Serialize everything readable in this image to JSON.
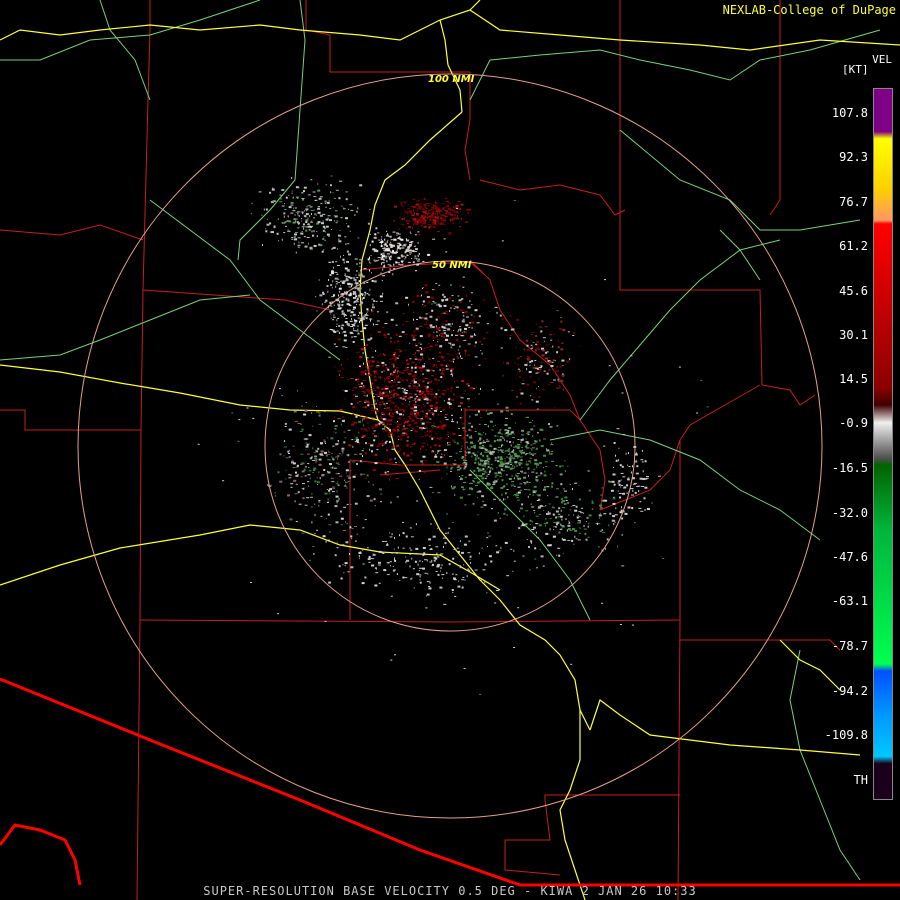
{
  "credit": "NEXLAB-College of DuPage",
  "footer": "SUPER-RESOLUTION BASE VELOCITY 0.5 DEG - KIWA 2 JAN 26 10:33",
  "legend": {
    "product": "VEL",
    "unit": "[KT]",
    "labels": [
      "107.8",
      "92.3",
      "76.7",
      "61.2",
      "45.6",
      "30.1",
      "14.5",
      "-0.9",
      "-16.5",
      "-32.0",
      "-47.6",
      "-63.1",
      "-78.7",
      "-94.2",
      "-109.8",
      "TH"
    ]
  },
  "range_rings": [
    {
      "label": "100 NMI",
      "radius_nmi": 100
    },
    {
      "label": "50 NMI",
      "radius_nmi": 50
    }
  ],
  "colors": {
    "county_lines": "#c81e1e",
    "highways": "#ffff3c",
    "rivers": "#78d278",
    "border": "#ff0000",
    "rings": "#e6a08c",
    "credit": "#ffff3c"
  },
  "colorbar_stops": [
    {
      "color": "#7d0087"
    },
    {
      "color": "#ffff00"
    },
    {
      "color": "#ff9664"
    },
    {
      "color": "#ff0000"
    },
    {
      "color": "#8c0000"
    },
    {
      "color": "#f0f0f0"
    },
    {
      "color": "#006400"
    },
    {
      "color": "#00ff50"
    },
    {
      "color": "#0050ff"
    },
    {
      "color": "#00c8ff"
    },
    {
      "color": "#1a001a"
    }
  ]
}
